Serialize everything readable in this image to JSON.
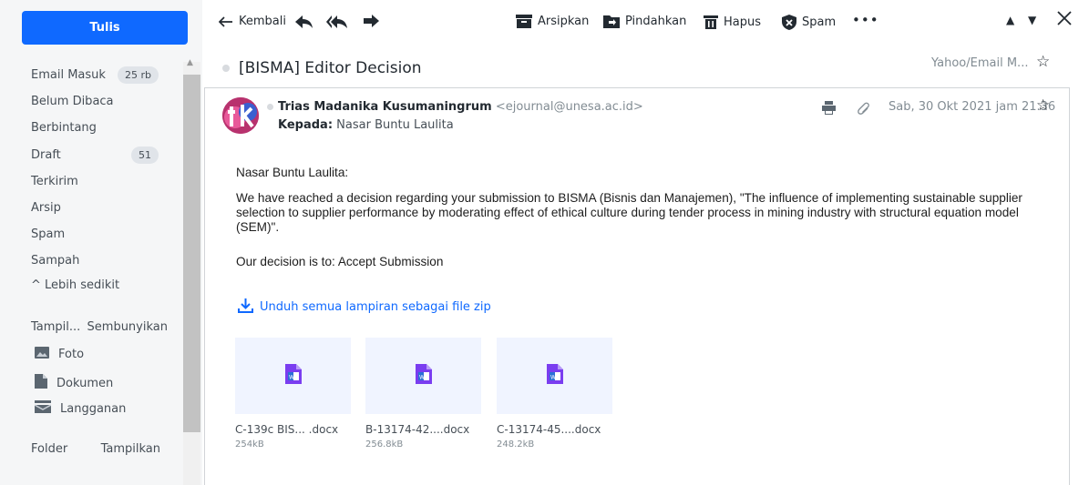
{
  "sidebar": {
    "compose_label": "Tulis",
    "folders": [
      {
        "label": "Email Masuk",
        "badge": "25 rb"
      },
      {
        "label": "Belum Dibaca",
        "badge": ""
      },
      {
        "label": "Berbintang",
        "badge": ""
      },
      {
        "label": "Draft",
        "badge": "51"
      },
      {
        "label": "Terkirim",
        "badge": ""
      },
      {
        "label": "Arsip",
        "badge": ""
      },
      {
        "label": "Spam",
        "badge": ""
      },
      {
        "label": "Sampah",
        "badge": ""
      }
    ],
    "less_label": "^ Lebih sedikit",
    "views_label": "Tampil...",
    "hide_label": "Sembunyikan",
    "views": [
      "Foto",
      "Dokumen",
      "Langganan"
    ],
    "folder_label": "Folder",
    "show_label": "Tampilkan"
  },
  "toolbar": {
    "back_label": "Kembali",
    "archive_label": "Arsipkan",
    "move_label": "Pindahkan",
    "delete_label": "Hapus",
    "spam_label": "Spam",
    "more_label": "•••"
  },
  "message": {
    "subject": "[BISMA] Editor Decision",
    "folder": "Yahoo/Email M...",
    "sender_name": "Trias Madanika Kusumaningrum",
    "sender_email": "<ejournal@unesa.ac.id>",
    "to_label": "Kepada:",
    "to_name": "Nasar Buntu Laulita",
    "date": "Sab, 30 Okt 2021 jam 21.36",
    "greeting": "Nasar Buntu Laulita:",
    "paragraph_lines": [
      "We have reached a decision regarding your submission to BISMA (Bisnis dan Manajemen), \"The influence of implementing sustainable supplier",
      "selection to supplier performance by moderating effect of ethical culture during tender process in mining industry with structural equation model",
      "(SEM)\"."
    ],
    "decision": "Our decision is to: Accept Submission",
    "download_label": "Unduh semua lampiran sebagai file zip",
    "attachments": [
      {
        "name": "C-139c BIS... .docx",
        "size": "254kB"
      },
      {
        "name": "B-13174-42....docx",
        "size": "256.8kB"
      },
      {
        "name": "C-13174-45....docx",
        "size": "248.2kB"
      }
    ]
  },
  "colors": {
    "accent": "#0f69ff",
    "sidebar_bg": "#f5f6f7",
    "attachment_bg": "#f0f4ff",
    "docx_icon": "#7a3df0"
  }
}
